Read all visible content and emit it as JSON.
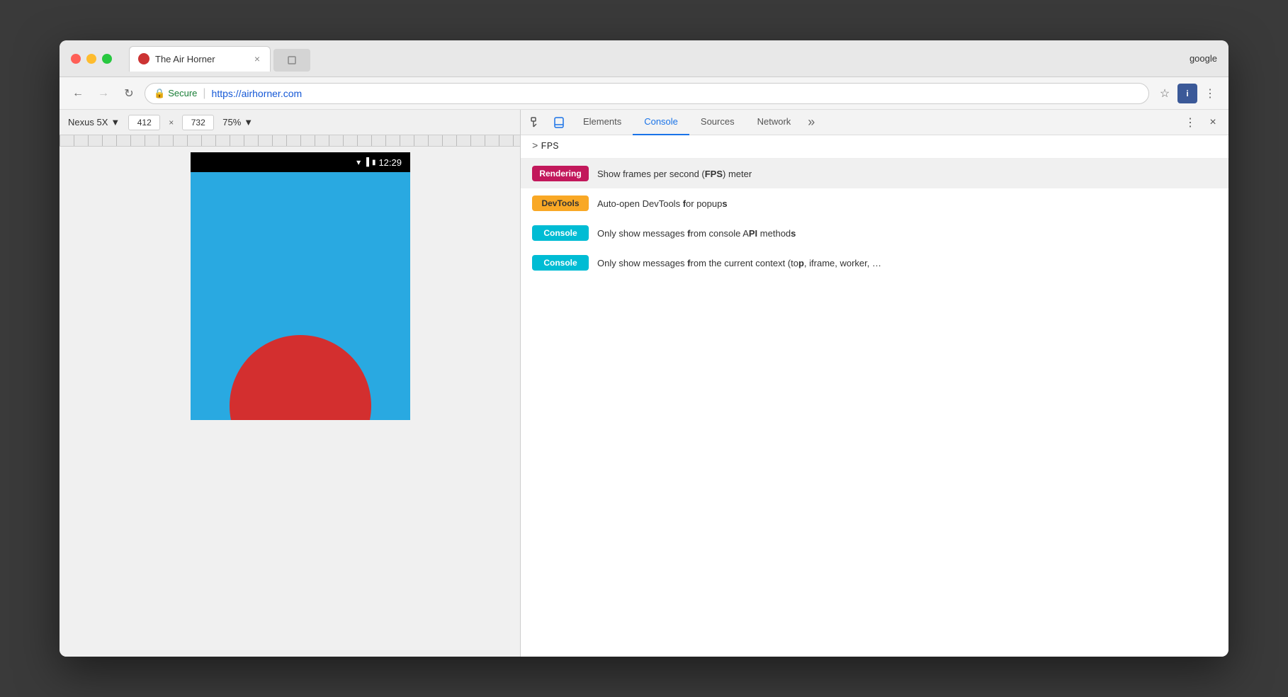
{
  "browser": {
    "title": "The Air Horner",
    "tab_close": "×",
    "profile": "google",
    "url_secure": "Secure",
    "url_full": "https://airhorner.com",
    "back_btn": "←",
    "forward_btn": "→",
    "reload_btn": "↻"
  },
  "device_toolbar": {
    "device_name": "Nexus 5X",
    "width": "412",
    "height": "732",
    "zoom": "75%"
  },
  "phone": {
    "time": "12:29"
  },
  "devtools": {
    "tabs": [
      "Elements",
      "Console",
      "Sources",
      "Network"
    ],
    "active_tab": "Console",
    "more_tabs": "»",
    "close": "×"
  },
  "console": {
    "prompt": ">",
    "input_value": "FPS"
  },
  "autocomplete": {
    "items": [
      {
        "badge_label": "Rendering",
        "badge_class": "badge-rendering",
        "text_parts": [
          "Show frames per second (",
          "FPS",
          ") meter"
        ],
        "bold_indices": [
          1
        ]
      },
      {
        "badge_label": "DevTools",
        "badge_class": "badge-devtools",
        "text_parts": [
          "Auto-open DevTools ",
          "f",
          "or popup",
          "s"
        ],
        "bold_indices": [
          1,
          3
        ]
      },
      {
        "badge_label": "Console",
        "badge_class": "badge-console",
        "text_parts": [
          "Only show messages ",
          "f",
          "rom console A",
          "PI",
          " method",
          "s"
        ],
        "bold_indices": [
          1,
          3,
          5
        ]
      },
      {
        "badge_label": "Console",
        "badge_class": "badge-console",
        "text_parts": [
          "Only show messages ",
          "f",
          "rom the current context (to",
          "p",
          ", iframe, worker, …"
        ],
        "bold_indices": [
          1,
          3
        ]
      }
    ]
  }
}
